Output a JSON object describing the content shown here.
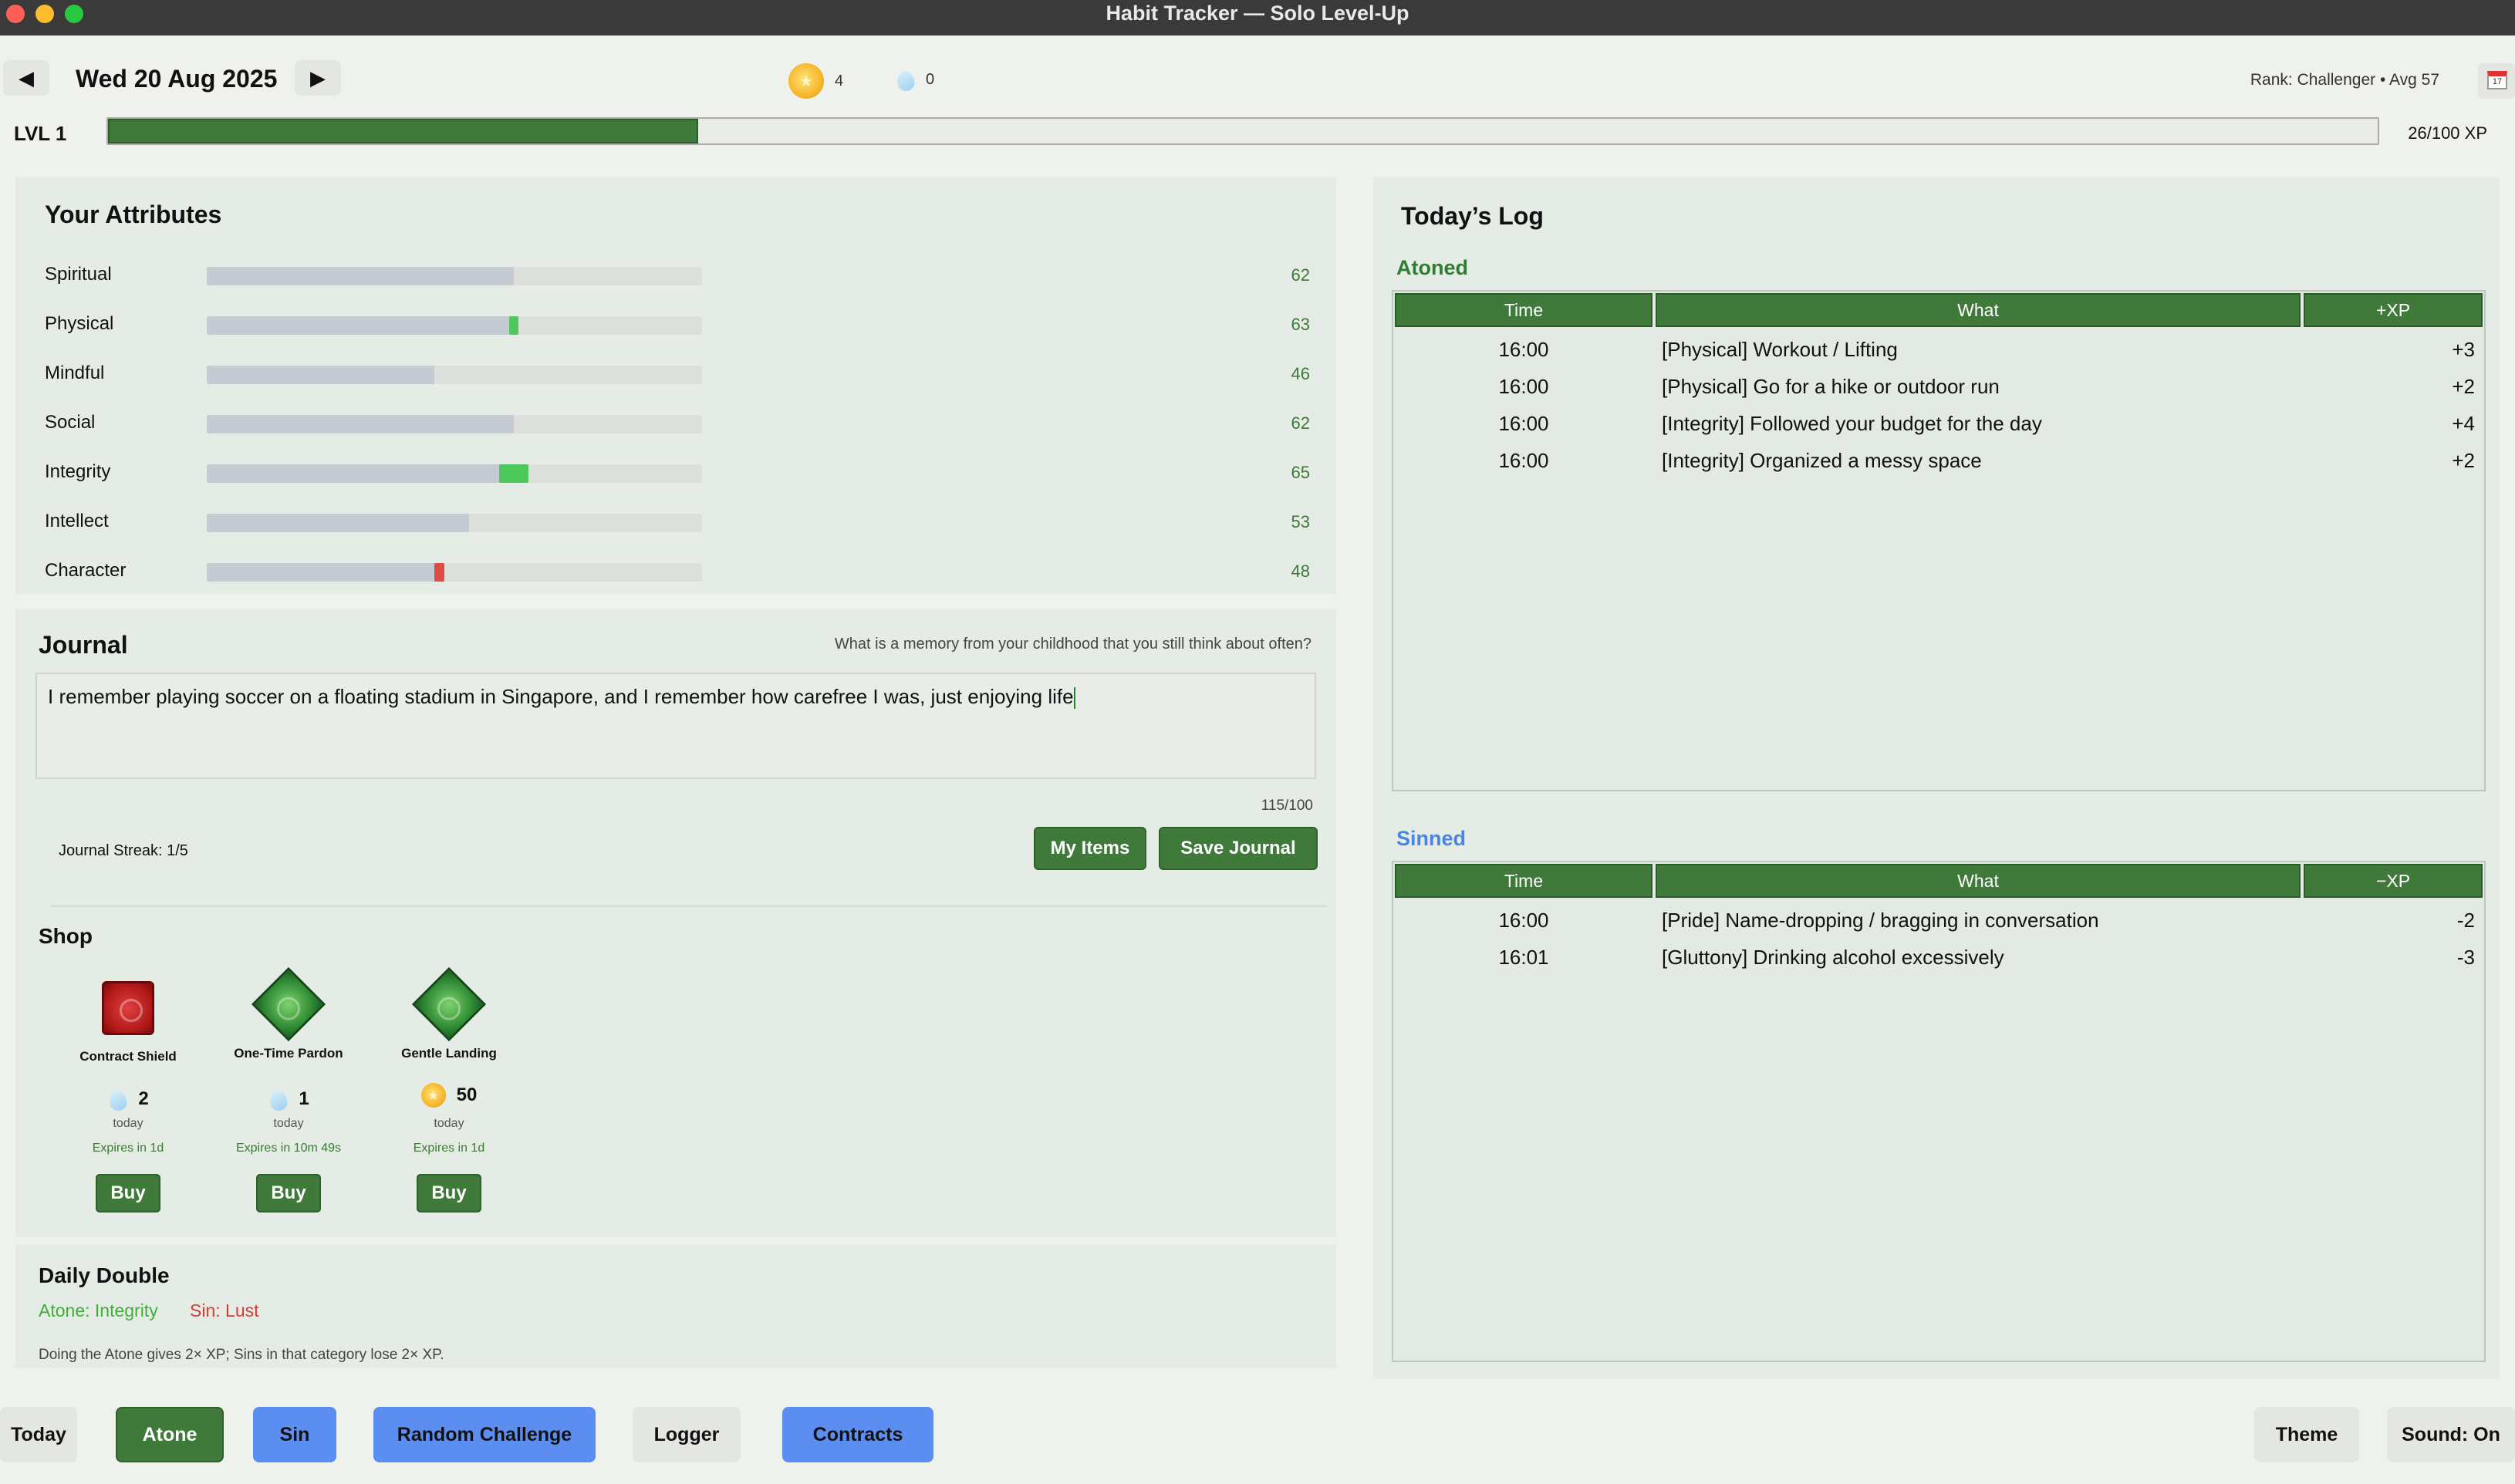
{
  "window": {
    "title": "Habit Tracker — Solo Level-Up"
  },
  "header": {
    "date": "Wed 20 Aug 2025",
    "coins": "4",
    "tears": "0",
    "rank_text": "Rank: Challenger  •  Avg 57",
    "prev_icon": "left-triangle-icon",
    "next_icon": "right-triangle-icon",
    "calendar_day": "17"
  },
  "level": {
    "label": "LVL 1",
    "xp_text": "26/100 XP",
    "xp_fraction": 0.26
  },
  "attributes": {
    "title": "Your Attributes",
    "items": [
      {
        "name": "Spiritual",
        "value": "62",
        "level": 62
      },
      {
        "name": "Physical",
        "value": "63",
        "level": 63,
        "delta": "up"
      },
      {
        "name": "Mindful",
        "value": "46",
        "level": 46
      },
      {
        "name": "Social",
        "value": "62",
        "level": 62
      },
      {
        "name": "Integrity",
        "value": "65",
        "level": 65,
        "delta": "up"
      },
      {
        "name": "Intellect",
        "value": "53",
        "level": 53
      },
      {
        "name": "Character",
        "value": "48",
        "level": 48,
        "delta": "down"
      }
    ]
  },
  "journal": {
    "title": "Journal",
    "prompt": "What is a memory from your childhood that you still think about often?",
    "text": "I remember playing soccer on a floating stadium in Singapore, and I remember how carefree I was, just enjoying life",
    "count": "115/100",
    "streak": "Journal Streak: 1/5",
    "my_items_label": "My Items",
    "save_label": "Save Journal"
  },
  "shop": {
    "title": "Shop",
    "items": [
      {
        "name": "Contract Shield",
        "price": "2",
        "currency": "tear-drop-icon",
        "when": "today",
        "expires": "Expires in 1d",
        "buy": "Buy"
      },
      {
        "name": "One-Time Pardon",
        "price": "1",
        "currency": "tear-drop-icon",
        "when": "today",
        "expires": "Expires in 10m 49s",
        "buy": "Buy"
      },
      {
        "name": "Gentle Landing",
        "price": "50",
        "currency": "coin-icon",
        "when": "today",
        "expires": "Expires in 1d",
        "buy": "Buy"
      }
    ]
  },
  "daily": {
    "title": "Daily Double",
    "atone": "Atone: Integrity",
    "sin": "Sin: Lust",
    "note": "Doing the Atone gives 2× XP; Sins in that category lose 2× XP."
  },
  "log": {
    "title": "Today’s Log",
    "atoned": {
      "title": "Atoned",
      "headers": [
        "Time",
        "What",
        "+XP"
      ],
      "rows": [
        {
          "time": "16:00",
          "what": "[Physical] Workout / Lifting",
          "xp": "+3"
        },
        {
          "time": "16:00",
          "what": "[Physical] Go for a hike or outdoor run",
          "xp": "+2"
        },
        {
          "time": "16:00",
          "what": "[Integrity] Followed your budget for the day",
          "xp": "+4"
        },
        {
          "time": "16:00",
          "what": "[Integrity] Organized a messy space",
          "xp": "+2"
        }
      ]
    },
    "sinned": {
      "title": "Sinned",
      "headers": [
        "Time",
        "What",
        "−XP"
      ],
      "rows": [
        {
          "time": "16:00",
          "what": "[Pride] Name-dropping / bragging in conversation",
          "xp": "-2"
        },
        {
          "time": "16:01",
          "what": "[Gluttony] Drinking alcohol excessively",
          "xp": "-3"
        }
      ]
    }
  },
  "bottom": {
    "today": "Today",
    "atone": "Atone",
    "sin": "Sin",
    "random": "Random Challenge",
    "logger": "Logger",
    "contracts": "Contracts",
    "theme": "Theme",
    "sound": "Sound: On"
  },
  "colors": {
    "accent_green": "#3f7a3b",
    "accent_blue": "#5b8ef0",
    "positive": "#3fae3a",
    "negative": "#d83b35",
    "atoned_title": "#2e7d32",
    "sinned_title": "#4a86e0"
  }
}
